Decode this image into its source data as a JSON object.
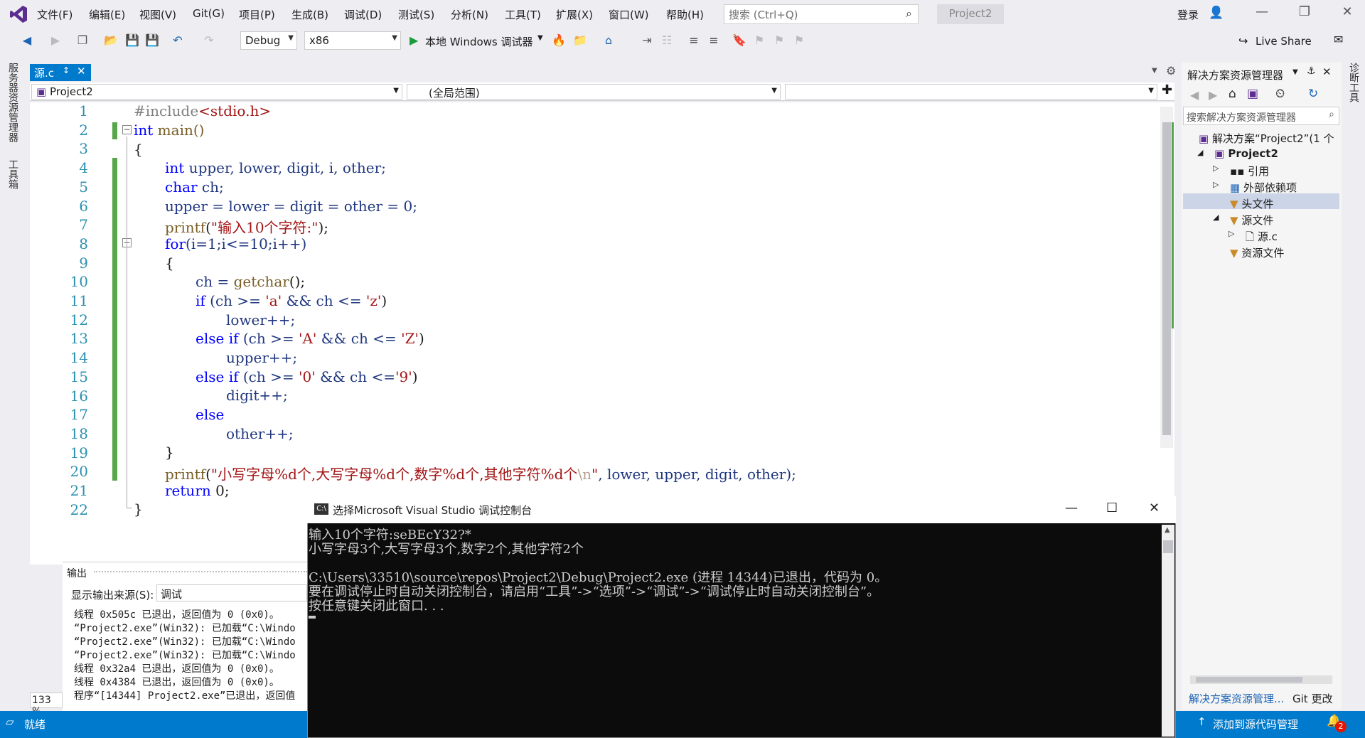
{
  "menu": {
    "items": [
      "文件(F)",
      "编辑(E)",
      "视图(V)",
      "Git(G)",
      "项目(P)",
      "生成(B)",
      "调试(D)",
      "测试(S)",
      "分析(N)",
      "工具(T)",
      "扩展(X)",
      "窗口(W)",
      "帮助(H)"
    ],
    "search_placeholder": "搜索 (Ctrl+Q)",
    "project_title": "Project2",
    "login": "登录"
  },
  "toolbar": {
    "config": "Debug",
    "platform": "x86",
    "run_label": "本地 Windows 调试器",
    "live_share": "Live Share"
  },
  "left_strip": {
    "server_explorer": "服务器资源管理器",
    "toolbox": "工具箱"
  },
  "right_strip": {
    "diagnostics": "诊断工具"
  },
  "editor": {
    "tab_label": "源.c",
    "nav_project": "Project2",
    "nav_scope": "(全局范围)",
    "zoom": "133 %"
  },
  "output": {
    "title": "输出",
    "source_label": "显示输出来源(S):",
    "source_value": "调试",
    "lines": [
      "线程 0x505c 已退出，返回值为 0 (0x0)。",
      "“Project2.exe”(Win32): 已加载“C:\\Windo",
      "“Project2.exe”(Win32): 已加载“C:\\Windo",
      "“Project2.exe”(Win32): 已加载“C:\\Windo",
      "线程 0x32a4 已退出，返回值为 0 (0x0)。",
      "线程 0x4384 已退出，返回值为 0 (0x0)。",
      "程序“[14344] Project2.exe”已退出，返回值"
    ]
  },
  "solution_explorer": {
    "title": "解决方案资源管理器",
    "search_placeholder": "搜索解决方案资源管理器",
    "solution": "解决方案“Project2”(1 个",
    "project": "Project2",
    "references": "引用",
    "external_deps": "外部依赖项",
    "headers": "头文件",
    "sources": "源文件",
    "source_file": "源.c",
    "resources": "资源文件",
    "bottom_tab_1": "解决方案资源管理...",
    "bottom_tab_2": "Git 更改"
  },
  "statusbar": {
    "ready": "就绪",
    "add_source_control": "添加到源代码管理",
    "notification_count": "2"
  },
  "console": {
    "title": "选择Microsoft Visual Studio 调试控制台",
    "lines": [
      "输入10个字符:seBEcY32?*",
      "小写字母3个,大写字母3个,数字2个,其他字符2个",
      "",
      "C:\\Users\\33510\\source\\repos\\Project2\\Debug\\Project2.exe (进程 14344)已退出，代码为 0。",
      "要在调试停止时自动关闭控制台，请启用“工具”->“选项”->“调试”->“调试停止时自动关闭控制台”。",
      "按任意键关闭此窗口. . ."
    ]
  },
  "code": {
    "line_numbers": [
      "1",
      "2",
      "3",
      "4",
      "5",
      "6",
      "7",
      "8",
      "9",
      "10",
      "11",
      "12",
      "13",
      "14",
      "15",
      "16",
      "17",
      "18",
      "19",
      "20",
      "21",
      "22"
    ],
    "l1_a": "#include",
    "l1_b": "<stdio.h>",
    "l2_kw": "int",
    "l2_fn": " main()",
    "l3": "{",
    "l4_kw": "int",
    "l4_rest": " upper, lower, digit, i, other;",
    "l5_kw": "char",
    "l5_rest": " ch;",
    "l6": "upper = lower = digit = other = 0;",
    "l7_fn": "printf",
    "l7_a": "(",
    "l7_str": "\"输入10个字符:\"",
    "l7_b": ");",
    "l8_kw": "for",
    "l8_rest": "(i=1;i<=10;i++)",
    "l9": "{",
    "l10_a": "ch = ",
    "l10_fn": "getchar",
    "l10_b": "();",
    "l11_kw": "if",
    "l11_a": " (ch >= ",
    "l11_s1": "'a'",
    "l11_b": " && ch <= ",
    "l11_s2": "'z'",
    "l11_c": ")",
    "l12": "lower++;",
    "l13_kw": "else if",
    "l13_a": " (ch >= ",
    "l13_s1": "'A'",
    "l13_b": " && ch <= ",
    "l13_s2": "'Z'",
    "l13_c": ")",
    "l14": "upper++;",
    "l15_kw": "else if",
    "l15_a": " (ch >= ",
    "l15_s1": "'0'",
    "l15_b": " && ch <=",
    "l15_s2": "'9'",
    "l15_c": ")",
    "l16": "digit++;",
    "l17_kw": "else",
    "l18": "other++;",
    "l19": "}",
    "l20_fn": "printf",
    "l20_a": "(",
    "l20_str": "\"小写字母%d个,大写字母%d个,数字%d个,其他字符%d个",
    "l20_esc": "\\n",
    "l20_str2": "\"",
    "l20_b": ", lower, upper, digit, other);",
    "l21_kw": "return",
    "l21_rest": " 0;",
    "l22": "}"
  }
}
